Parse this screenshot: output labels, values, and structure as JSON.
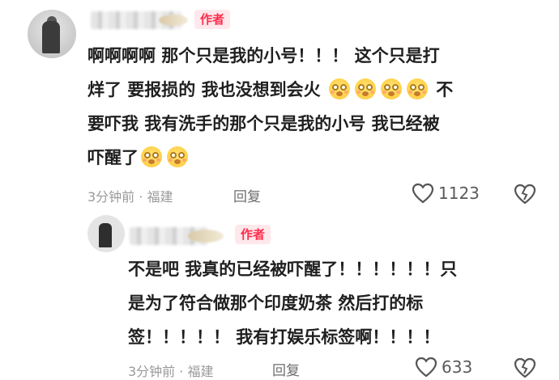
{
  "comment": {
    "badge": "作者",
    "text_lines": [
      "啊啊啊啊 那个只是我的小号！！！ 这个只是打",
      "烊了 要报损的 我也没想到会火",
      "要吓我 我有洗手的那个只是我的小号 我已经被",
      "吓醒了"
    ],
    "text_after_emoji_line2": "不",
    "meta": "3分钟前 · 福建",
    "reply_label": "回复",
    "like_count": "1123",
    "icons": [
      "heart-icon",
      "dislike-icon",
      "flushed-emoji"
    ]
  },
  "reply": {
    "badge": "作者",
    "text_lines": [
      "不是吧 我真的已经被吓醒了！！！！！！只",
      "是为了符合做那个印度奶茶 然后打的标",
      "签！！！！！ 我有打娱乐标签啊！！！！"
    ],
    "meta": "3分钟前 · 福建",
    "reply_label": "回复",
    "like_count": "633"
  },
  "colors": {
    "badge_text": "#ff2c4b",
    "badge_bg": "#ffe8eb",
    "meta": "#9a9a9a",
    "text": "#1f1f1f"
  }
}
